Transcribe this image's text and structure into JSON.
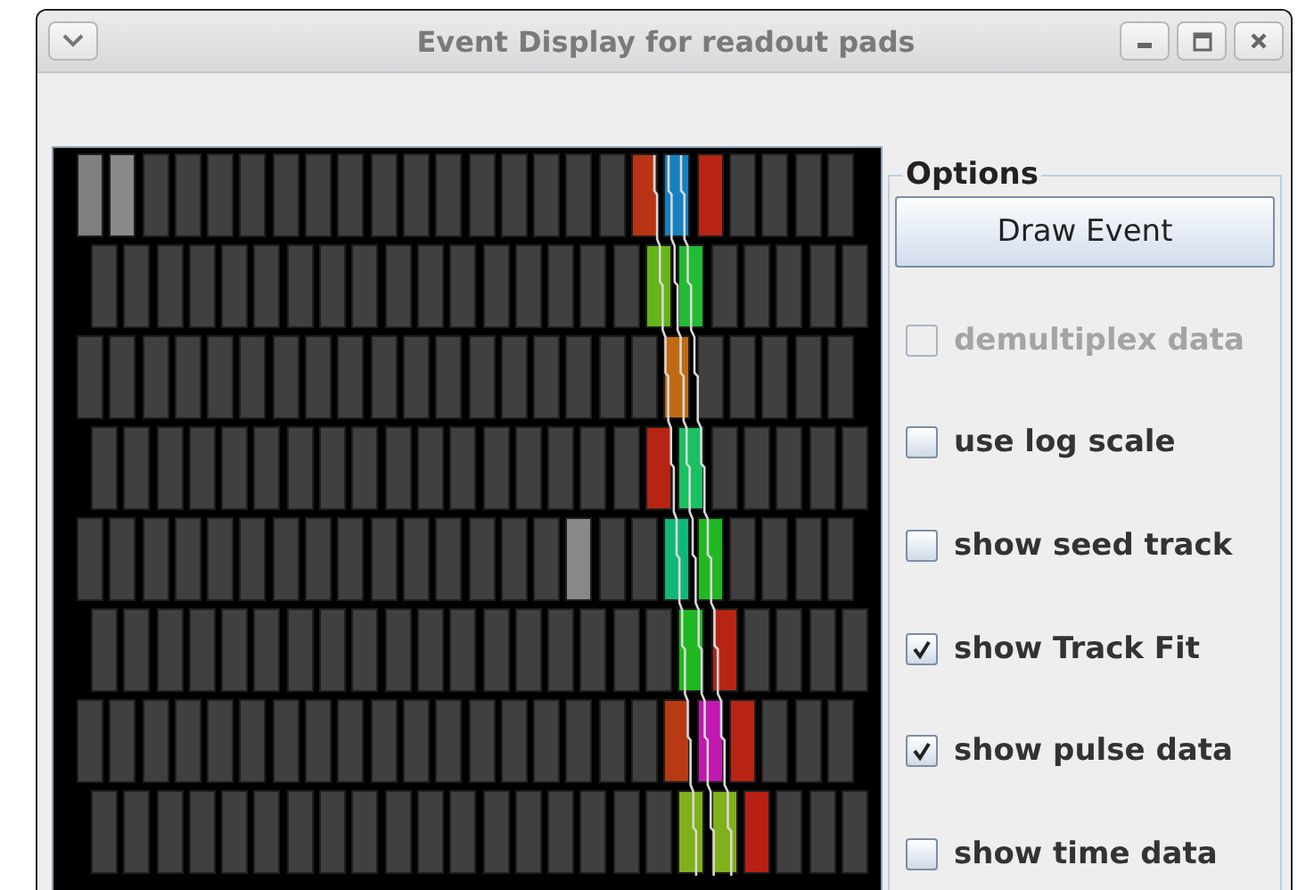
{
  "window": {
    "title": "Event Display for readout pads"
  },
  "pad_rows": [
    {
      "pads": [
        {
          "color": "#808080"
        },
        {
          "color": "#8a8a8a"
        },
        {
          "color": "#404040"
        },
        {
          "color": "#404040"
        },
        {
          "color": "#404040"
        },
        {
          "color": "#404040"
        },
        {
          "color": "#404040"
        },
        {
          "color": "#404040"
        },
        {
          "color": "#404040"
        },
        {
          "color": "#404040"
        },
        {
          "color": "#404040"
        },
        {
          "color": "#404040"
        },
        {
          "color": "#404040"
        },
        {
          "color": "#404040"
        },
        {
          "color": "#404040"
        },
        {
          "color": "#404040"
        },
        {
          "color": "#404040"
        },
        {
          "color": "#b83414"
        },
        {
          "color": "#1680c0"
        },
        {
          "color": "#b82414"
        },
        {
          "color": "#404040"
        },
        {
          "color": "#404040"
        },
        {
          "color": "#404040"
        },
        {
          "color": "#404040"
        }
      ]
    },
    {
      "pads": [
        {
          "color": "#404040"
        },
        {
          "color": "#404040"
        },
        {
          "color": "#404040"
        },
        {
          "color": "#404040"
        },
        {
          "color": "#404040"
        },
        {
          "color": "#404040"
        },
        {
          "color": "#404040"
        },
        {
          "color": "#404040"
        },
        {
          "color": "#404040"
        },
        {
          "color": "#404040"
        },
        {
          "color": "#404040"
        },
        {
          "color": "#404040"
        },
        {
          "color": "#404040"
        },
        {
          "color": "#404040"
        },
        {
          "color": "#404040"
        },
        {
          "color": "#404040"
        },
        {
          "color": "#404040"
        },
        {
          "color": "#66b31a"
        },
        {
          "color": "#22bb33"
        },
        {
          "color": "#404040"
        },
        {
          "color": "#404040"
        },
        {
          "color": "#404040"
        },
        {
          "color": "#404040"
        },
        {
          "color": "#404040"
        }
      ]
    },
    {
      "pads": [
        {
          "color": "#404040"
        },
        {
          "color": "#404040"
        },
        {
          "color": "#404040"
        },
        {
          "color": "#404040"
        },
        {
          "color": "#404040"
        },
        {
          "color": "#404040"
        },
        {
          "color": "#404040"
        },
        {
          "color": "#404040"
        },
        {
          "color": "#404040"
        },
        {
          "color": "#404040"
        },
        {
          "color": "#404040"
        },
        {
          "color": "#404040"
        },
        {
          "color": "#404040"
        },
        {
          "color": "#404040"
        },
        {
          "color": "#404040"
        },
        {
          "color": "#404040"
        },
        {
          "color": "#404040"
        },
        {
          "color": "#404040"
        },
        {
          "color": "#c06a14"
        },
        {
          "color": "#404040"
        },
        {
          "color": "#404040"
        },
        {
          "color": "#404040"
        },
        {
          "color": "#404040"
        },
        {
          "color": "#404040"
        }
      ]
    },
    {
      "pads": [
        {
          "color": "#404040"
        },
        {
          "color": "#404040"
        },
        {
          "color": "#404040"
        },
        {
          "color": "#404040"
        },
        {
          "color": "#404040"
        },
        {
          "color": "#404040"
        },
        {
          "color": "#404040"
        },
        {
          "color": "#404040"
        },
        {
          "color": "#404040"
        },
        {
          "color": "#404040"
        },
        {
          "color": "#404040"
        },
        {
          "color": "#404040"
        },
        {
          "color": "#404040"
        },
        {
          "color": "#404040"
        },
        {
          "color": "#404040"
        },
        {
          "color": "#404040"
        },
        {
          "color": "#404040"
        },
        {
          "color": "#b82414"
        },
        {
          "color": "#18c060"
        },
        {
          "color": "#404040"
        },
        {
          "color": "#404040"
        },
        {
          "color": "#404040"
        },
        {
          "color": "#404040"
        },
        {
          "color": "#404040"
        }
      ]
    },
    {
      "pads": [
        {
          "color": "#404040"
        },
        {
          "color": "#404040"
        },
        {
          "color": "#404040"
        },
        {
          "color": "#404040"
        },
        {
          "color": "#404040"
        },
        {
          "color": "#404040"
        },
        {
          "color": "#404040"
        },
        {
          "color": "#404040"
        },
        {
          "color": "#404040"
        },
        {
          "color": "#404040"
        },
        {
          "color": "#404040"
        },
        {
          "color": "#404040"
        },
        {
          "color": "#404040"
        },
        {
          "color": "#404040"
        },
        {
          "color": "#404040"
        },
        {
          "color": "#888888"
        },
        {
          "color": "#404040"
        },
        {
          "color": "#404040"
        },
        {
          "color": "#10b878"
        },
        {
          "color": "#22b822"
        },
        {
          "color": "#404040"
        },
        {
          "color": "#404040"
        },
        {
          "color": "#404040"
        },
        {
          "color": "#404040"
        }
      ]
    },
    {
      "pads": [
        {
          "color": "#404040"
        },
        {
          "color": "#404040"
        },
        {
          "color": "#404040"
        },
        {
          "color": "#404040"
        },
        {
          "color": "#404040"
        },
        {
          "color": "#404040"
        },
        {
          "color": "#404040"
        },
        {
          "color": "#404040"
        },
        {
          "color": "#404040"
        },
        {
          "color": "#404040"
        },
        {
          "color": "#404040"
        },
        {
          "color": "#404040"
        },
        {
          "color": "#404040"
        },
        {
          "color": "#404040"
        },
        {
          "color": "#404040"
        },
        {
          "color": "#404040"
        },
        {
          "color": "#404040"
        },
        {
          "color": "#404040"
        },
        {
          "color": "#20b820"
        },
        {
          "color": "#b82414"
        },
        {
          "color": "#404040"
        },
        {
          "color": "#404040"
        },
        {
          "color": "#404040"
        },
        {
          "color": "#404040"
        }
      ]
    },
    {
      "pads": [
        {
          "color": "#404040"
        },
        {
          "color": "#404040"
        },
        {
          "color": "#404040"
        },
        {
          "color": "#404040"
        },
        {
          "color": "#404040"
        },
        {
          "color": "#404040"
        },
        {
          "color": "#404040"
        },
        {
          "color": "#404040"
        },
        {
          "color": "#404040"
        },
        {
          "color": "#404040"
        },
        {
          "color": "#404040"
        },
        {
          "color": "#404040"
        },
        {
          "color": "#404040"
        },
        {
          "color": "#404040"
        },
        {
          "color": "#404040"
        },
        {
          "color": "#404040"
        },
        {
          "color": "#404040"
        },
        {
          "color": "#404040"
        },
        {
          "color": "#b83a14"
        },
        {
          "color": "#c018b0"
        },
        {
          "color": "#b82414"
        },
        {
          "color": "#404040"
        },
        {
          "color": "#404040"
        },
        {
          "color": "#404040"
        }
      ]
    },
    {
      "pads": [
        {
          "color": "#404040"
        },
        {
          "color": "#404040"
        },
        {
          "color": "#404040"
        },
        {
          "color": "#404040"
        },
        {
          "color": "#404040"
        },
        {
          "color": "#404040"
        },
        {
          "color": "#404040"
        },
        {
          "color": "#404040"
        },
        {
          "color": "#404040"
        },
        {
          "color": "#404040"
        },
        {
          "color": "#404040"
        },
        {
          "color": "#404040"
        },
        {
          "color": "#404040"
        },
        {
          "color": "#404040"
        },
        {
          "color": "#404040"
        },
        {
          "color": "#404040"
        },
        {
          "color": "#404040"
        },
        {
          "color": "#404040"
        },
        {
          "color": "#80b01a"
        },
        {
          "color": "#80b01a"
        },
        {
          "color": "#b82014"
        },
        {
          "color": "#404040"
        },
        {
          "color": "#404040"
        },
        {
          "color": "#404040"
        }
      ]
    }
  ],
  "options": {
    "title": "Options",
    "button": "Draw Event",
    "checkboxes": [
      {
        "label": "demultiplex data",
        "checked": false,
        "disabled": true
      },
      {
        "label": "use log scale",
        "checked": false,
        "disabled": false
      },
      {
        "label": "show seed track",
        "checked": false,
        "disabled": false
      },
      {
        "label": "show Track Fit",
        "checked": true,
        "disabled": false
      },
      {
        "label": "show pulse data",
        "checked": true,
        "disabled": false
      },
      {
        "label": "show time data",
        "checked": false,
        "disabled": false
      }
    ]
  }
}
